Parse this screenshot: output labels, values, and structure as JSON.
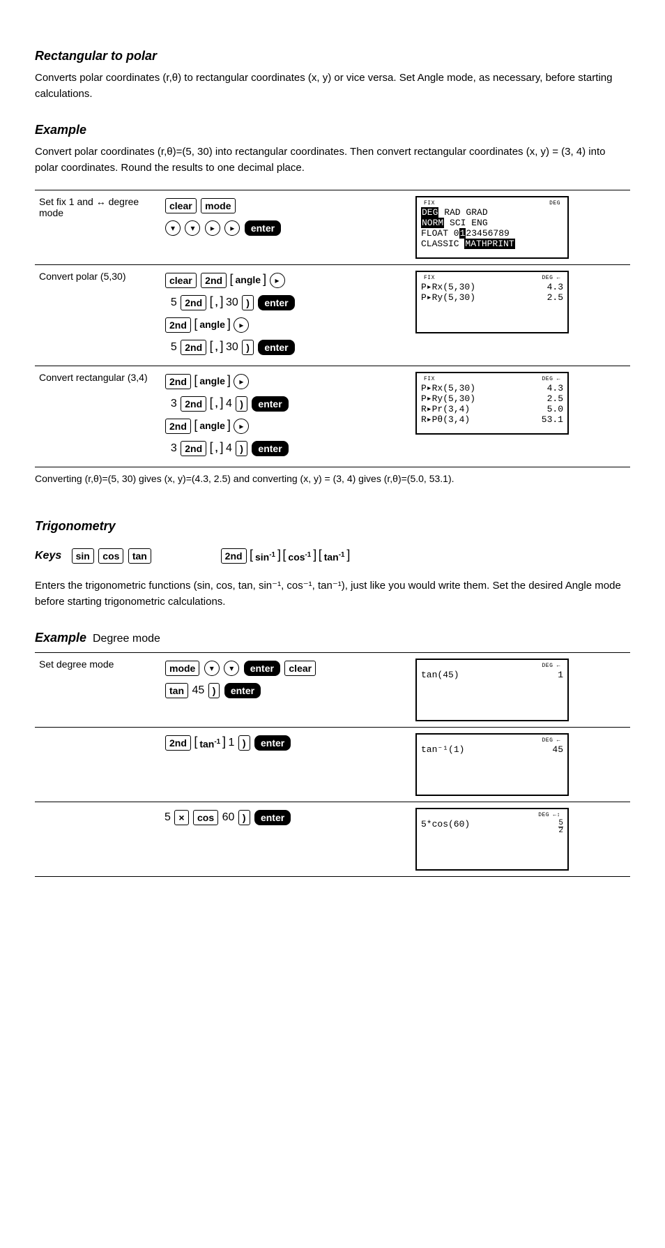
{
  "sec1": {
    "title": "Rectangular to polar",
    "intro_a": "Converts polar coordinates (r,",
    "intro_b": ") to rectangular coordinates (x, y) or vice versa. Set Angle mode, as necessary, before starting calculations.",
    "example_label": "Example",
    "example_desc_a": "Convert polar coordinates (r,",
    "example_desc_b": ")=(5, 30) into rectangular coordinates. Then convert rectangular coordinates (x, y) = (3, 4) into polar coordinates. Round the results to one decimal place.",
    "table": {
      "r1": {
        "c1_a": "Set fix 1 and ",
        "c1_b": " degree mode"
      },
      "r2": {
        "c1": "Convert polar (5,30)",
        "num_a": "5",
        "num_b": "30"
      },
      "r3": {
        "c1": "Convert rectangular (3,4)",
        "num_a": "3",
        "num_b": "4"
      }
    },
    "note_a": "Converting (r,",
    "note_b": ")=(5, 30) gives (x, y)=(4.3, 2.5) and converting (x, y) = (3, 4) gives (r,",
    "note_c": ")=(5.0, 53.1)."
  },
  "keys": {
    "clear": "clear",
    "mode": "mode",
    "enter": "enter",
    "second": "2nd",
    "angle": "angle",
    "comma": ",",
    "rparen": ")",
    "sin": "sin",
    "cos": "cos",
    "tan": "tan",
    "asin": "sin⁻¹",
    "acos": "cos⁻¹",
    "atan": "tan⁻¹",
    "mul": "×",
    "five": "5",
    "sixty": "60",
    "fortyfive": "45",
    "one": "1"
  },
  "screens": {
    "mode": {
      "top_l": "FIX",
      "top_r": "DEG",
      "l1a": "DEG",
      "l1b": " RAD GRAD",
      "l2a": "NORM",
      "l2b": " SCI ENG",
      "l3a": "FLOAT 0",
      "l3b": "1",
      "l3c": "23456789",
      "l4a": "CLASSIC ",
      "l4b": "MATHPRINT"
    },
    "polar1": {
      "top_l": "FIX",
      "top_r": "DEG    ←",
      "l1_l": "P▸Rx(5,30)",
      "l1_r": "4.3",
      "l2_l": "P▸Ry(5,30)",
      "l2_r": "2.5"
    },
    "polar2": {
      "top_l": "FIX",
      "top_r": "DEG    ←",
      "l1_l": "P▸Rx(5,30)",
      "l1_r": "4.3",
      "l2_l": "P▸Ry(5,30)",
      "l2_r": "2.5",
      "l3_l": "R▸Pr(3,4)",
      "l3_r": "5.0",
      "l4_l": "R▸Pθ(3,4)",
      "l4_r": "53.1"
    },
    "trig1": {
      "top_r": "DEG    ←",
      "l1_l": "tan(45)",
      "l1_r": "1"
    },
    "trig2": {
      "top_r": "DEG    ←",
      "l1_l": "tan⁻¹(1)",
      "l1_r": "45"
    },
    "trig3": {
      "top_r": "DEG   ←↕",
      "l1_l": "5*cos(60)",
      "frac_n": "5",
      "frac_d": "2"
    }
  },
  "sec2": {
    "title": "Trigonometry",
    "keys_label": "Keys",
    "desc": "Enters the trigonometric functions (sin, cos, tan, sin⁻¹, cos⁻¹, tan⁻¹), just like you would write them. Set the desired Angle mode before starting trigonometric calculations.",
    "example_label": "Example",
    "example_desc": "Degree mode",
    "table": {
      "r1": {
        "c1": "Set degree mode"
      },
      "r2": {
        "c1": ""
      },
      "r3": {
        "c1": ""
      }
    }
  },
  "theta": "θ",
  "lrarrow": "↔"
}
